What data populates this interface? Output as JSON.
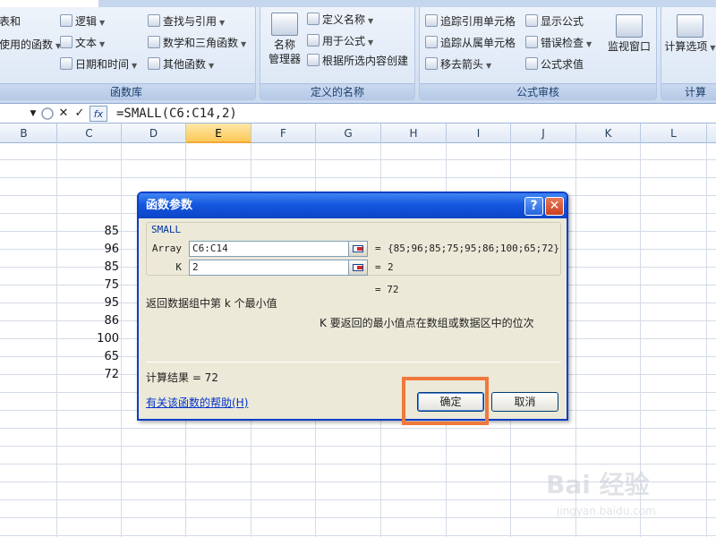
{
  "ribbon": {
    "function_library": {
      "label": "函数库",
      "partial_left_top": "表和",
      "partial_left_mid": "使用的函数",
      "logic": "逻辑",
      "text": "文本",
      "datetime": "日期和时间",
      "lookup": "查找与引用",
      "math": "数学和三角函数",
      "other": "其他函数"
    },
    "defined_names": {
      "label": "定义的名称",
      "name_manager_line1": "名称",
      "name_manager_line2": "管理器",
      "define_name": "定义名称",
      "use_in_formula": "用于公式",
      "create_from_selection": "根据所选内容创建"
    },
    "formula_auditing": {
      "label": "公式审核",
      "trace_precedents": "追踪引用单元格",
      "trace_dependents": "追踪从属单元格",
      "remove_arrows": "移去箭头",
      "show_formulas": "显示公式",
      "error_checking": "错误检查",
      "evaluate_formula": "公式求值",
      "watch_window": "监视窗口"
    },
    "calculation": {
      "label": "计算",
      "calc_options": "计算选项"
    }
  },
  "formula_bar": {
    "formula": "=SMALL(C6:C14,2)",
    "fx_label": "fx"
  },
  "columns": [
    "B",
    "C",
    "D",
    "E",
    "F",
    "G",
    "H",
    "I",
    "J",
    "K",
    "L"
  ],
  "active_column": "E",
  "column_c_values": [
    "85",
    "96",
    "85",
    "75",
    "95",
    "86",
    "100",
    "65",
    "72"
  ],
  "dialog": {
    "title": "函数参数",
    "help_glyph": "?",
    "close_glyph": "✕",
    "function_name": "SMALL",
    "args": [
      {
        "label": "Array",
        "input": "C6:C14",
        "value": "{85;96;85;75;95;86;100;65;72}"
      },
      {
        "label": "K",
        "input": "2",
        "value": "2"
      }
    ],
    "eq": "=",
    "result_preview": "= 72",
    "description": "返回数据组中第 k 个最小值",
    "arg_description": "K  要返回的最小值点在数组或数据区中的位次",
    "calc_result": "计算结果 =  72",
    "help_link": "有关该函数的帮助(H)",
    "ok": "确定",
    "cancel": "取消"
  },
  "watermark": {
    "logo": "Bai 经验",
    "sub": "jingyan.baidu.com"
  },
  "colors": {
    "accent_blue": "#0c45c8",
    "highlight_orange": "#f0783c",
    "active_col_header": "#fbc958"
  }
}
